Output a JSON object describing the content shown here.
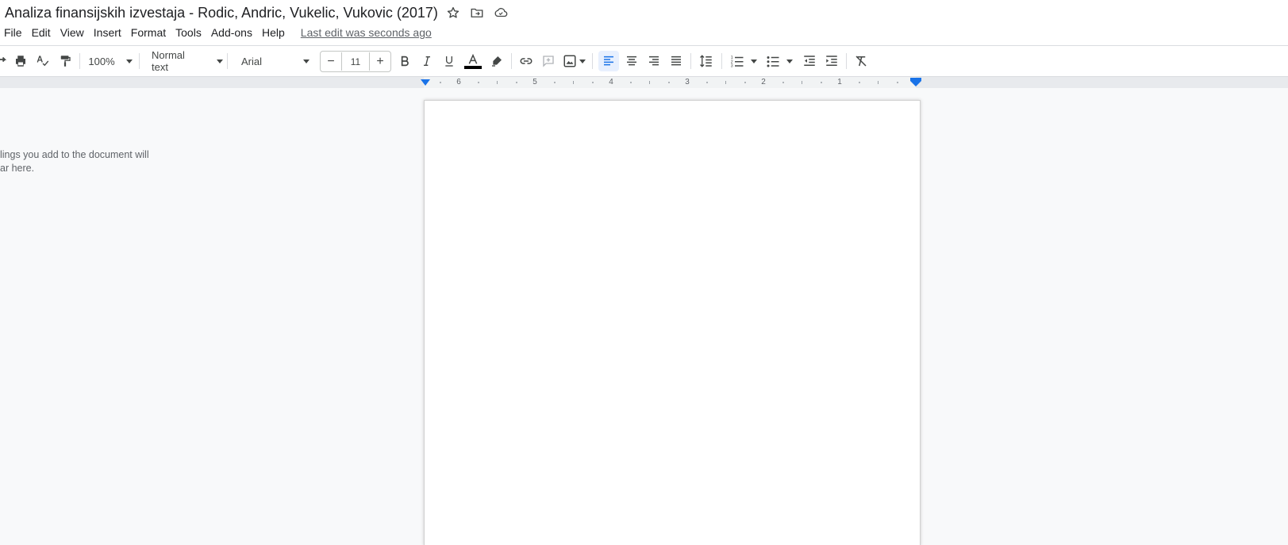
{
  "document": {
    "title": "Analiza finansijskih izvestaja - Rodic, Andric, Vukelic, Vukovic (2017)"
  },
  "menu": {
    "items": [
      "File",
      "Edit",
      "View",
      "Insert",
      "Format",
      "Tools",
      "Add-ons",
      "Help"
    ],
    "last_edit": "Last edit was seconds ago"
  },
  "toolbar": {
    "zoom": "100%",
    "style": "Normal text",
    "font": "Arial",
    "font_size": "11",
    "minus": "−",
    "plus": "+",
    "text_color": "#000000",
    "active_color": "#1a73e8"
  },
  "ruler": {
    "numbers": [
      "6",
      "5",
      "4",
      "3",
      "2",
      "1"
    ]
  },
  "outline": {
    "line1": "lings you add to the document will",
    "line2": "ar here."
  }
}
